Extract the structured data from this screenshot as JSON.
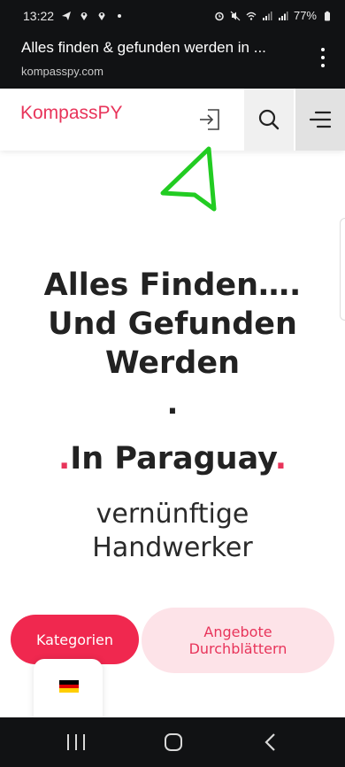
{
  "status_bar": {
    "time": "13:22",
    "battery": "77%"
  },
  "browser": {
    "page_title": "Alles finden & gefunden werden in ...",
    "url": "kompasspy.com",
    "menu_icon": "overflow-menu-icon"
  },
  "site_header": {
    "logo": "KompassPY",
    "login_icon": "login-icon",
    "search_icon": "search-icon",
    "menu_icon": "hamburger-menu-icon"
  },
  "hero": {
    "title_line1": "Alles Finden….",
    "title_line2": "Und Gefunden",
    "title_line3": "Werden",
    "separator": ".",
    "location_prefix": ".",
    "location": "In Paraguay",
    "location_suffix": ".",
    "subtitle_line1": "vernünftige",
    "subtitle_line2": "Handwerker"
  },
  "actions": {
    "categories_label": "Kategorien",
    "browse_line1": "Angebote",
    "browse_line2": "Durchblättern"
  },
  "language": {
    "flag_icon": "german-flag-icon",
    "flag_colors": [
      "#000000",
      "#dd0000",
      "#ffce00"
    ]
  },
  "colors": {
    "brand": "#e8345a",
    "primary_button": "#f0284f",
    "secondary_button_bg": "#fde3e8",
    "annotation": "#22cc22"
  }
}
